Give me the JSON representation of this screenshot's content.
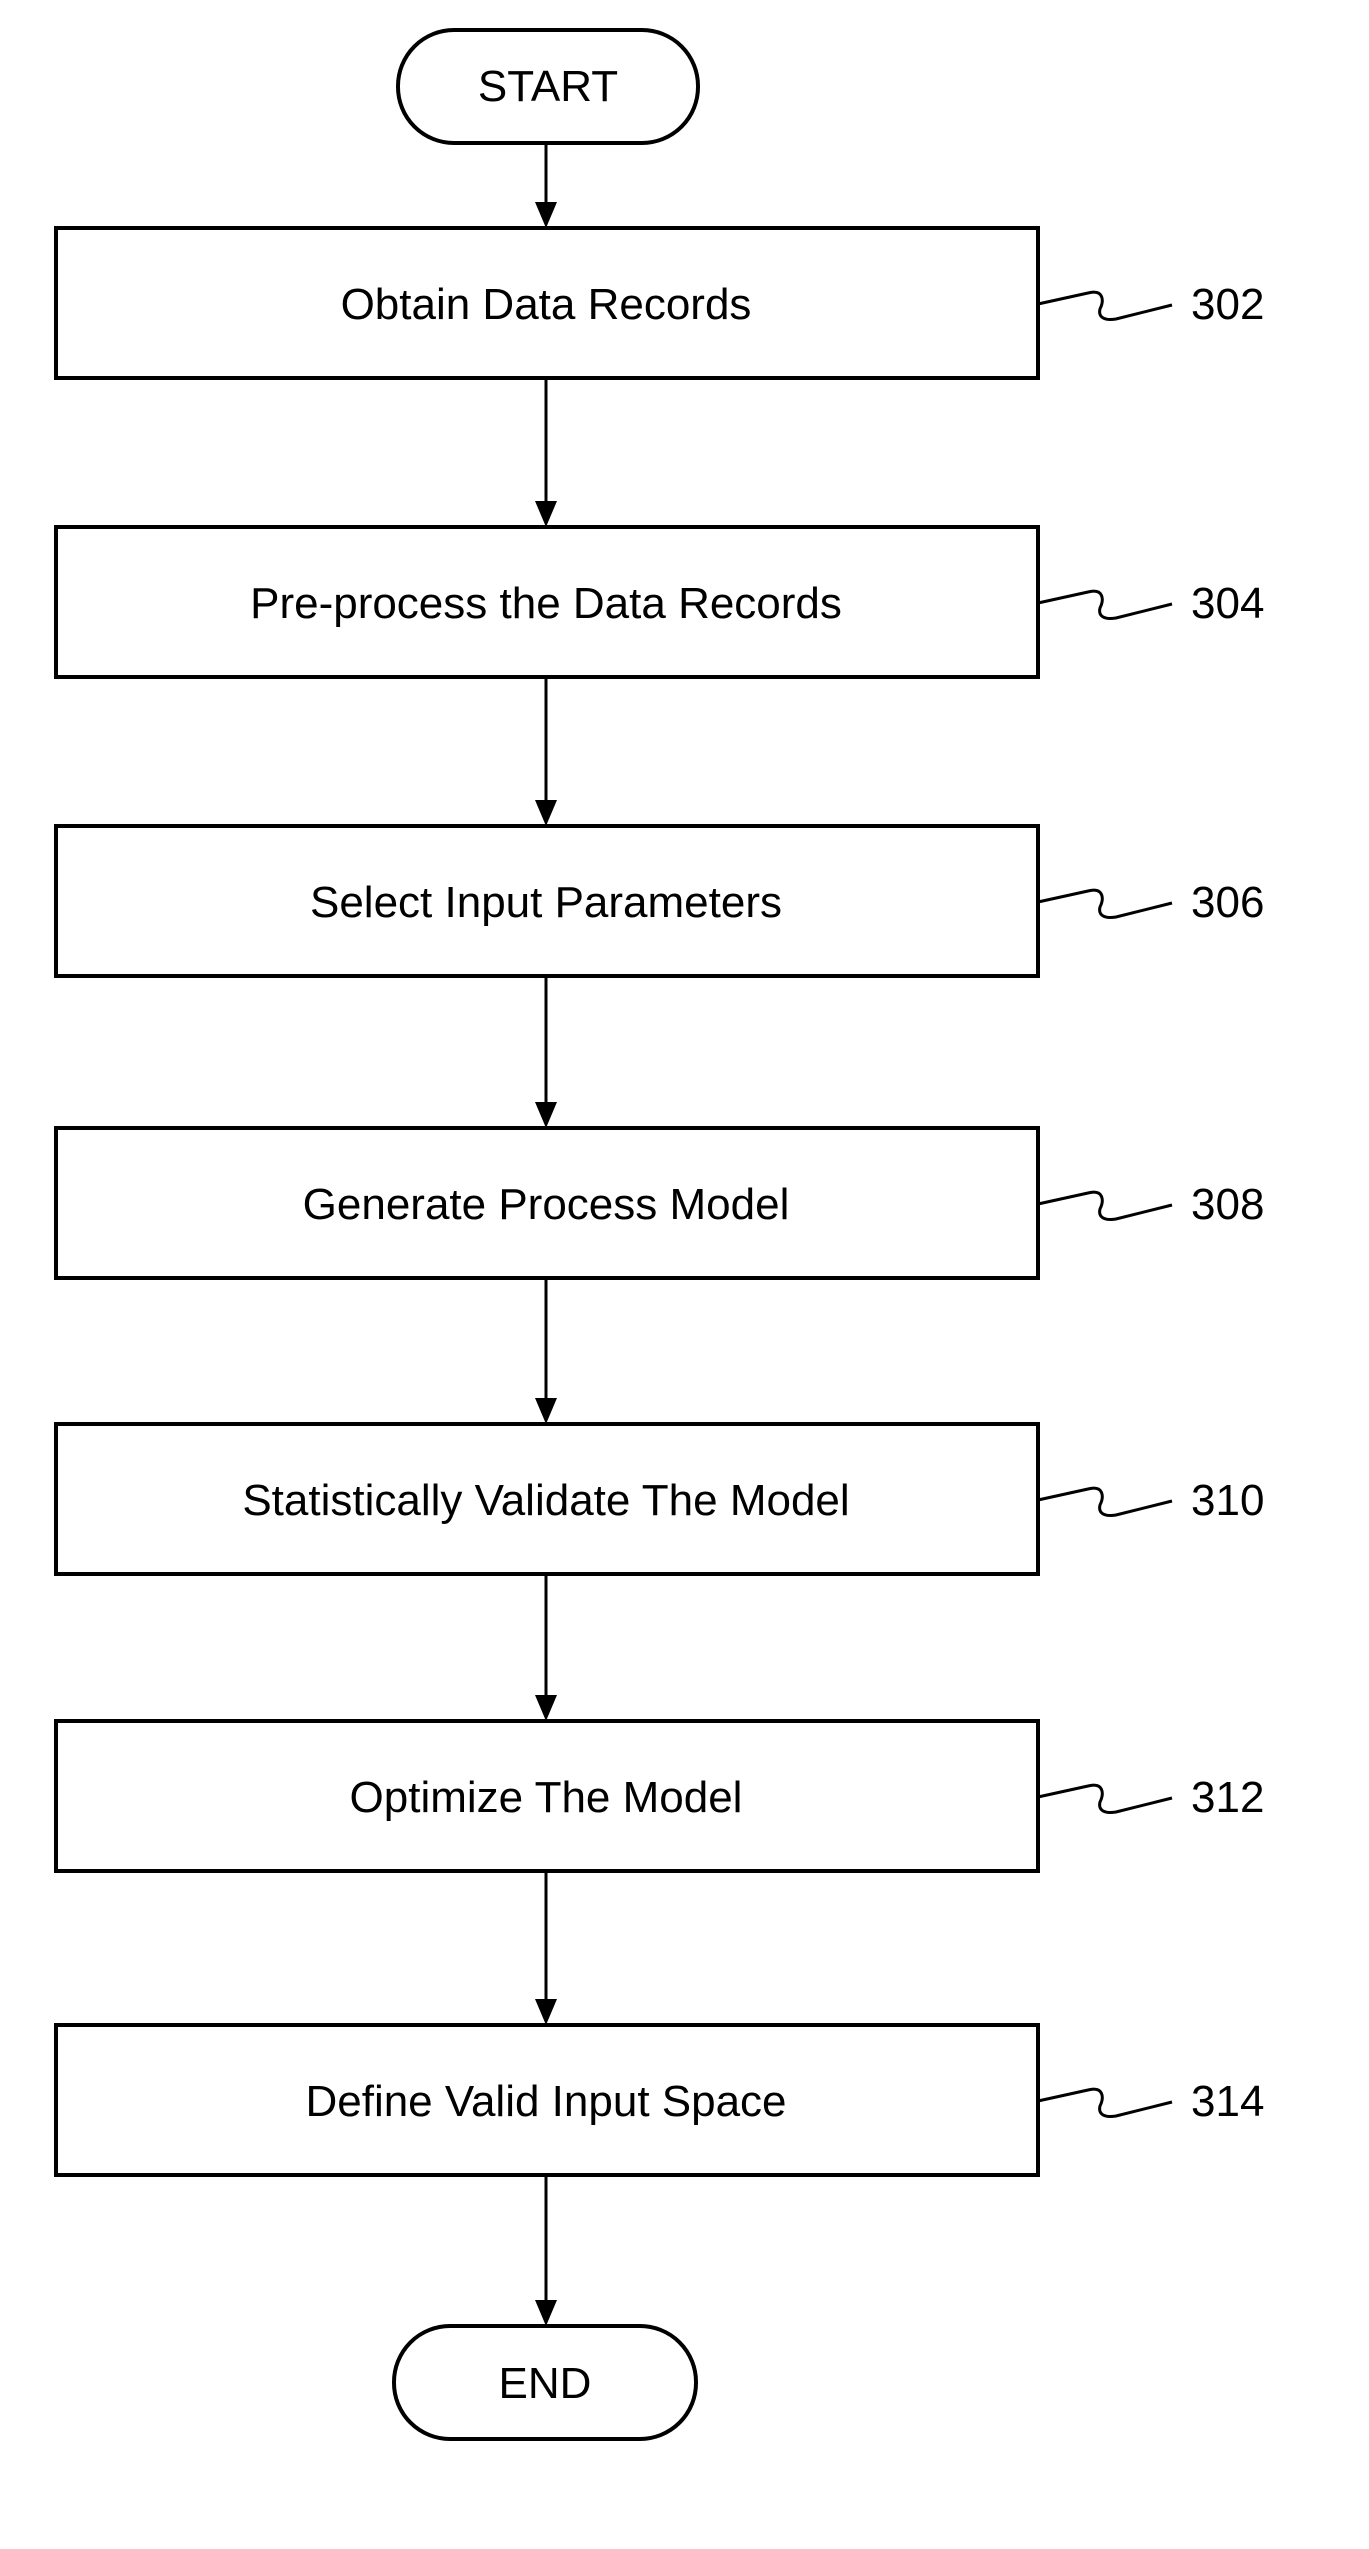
{
  "diagram": {
    "type": "flowchart",
    "start": {
      "label": "START"
    },
    "end": {
      "label": "END"
    },
    "steps": [
      {
        "label": "Obtain Data Records",
        "ref": "302"
      },
      {
        "label": "Pre-process the Data Records",
        "ref": "304"
      },
      {
        "label": "Select Input Parameters",
        "ref": "306"
      },
      {
        "label": "Generate Process Model",
        "ref": "308"
      },
      {
        "label": "Statistically Validate The Model",
        "ref": "310"
      },
      {
        "label": "Optimize The Model",
        "ref": "312"
      },
      {
        "label": "Define Valid Input Space",
        "ref": "314"
      }
    ],
    "colors": {
      "stroke": "#000000",
      "background": "#ffffff"
    }
  }
}
